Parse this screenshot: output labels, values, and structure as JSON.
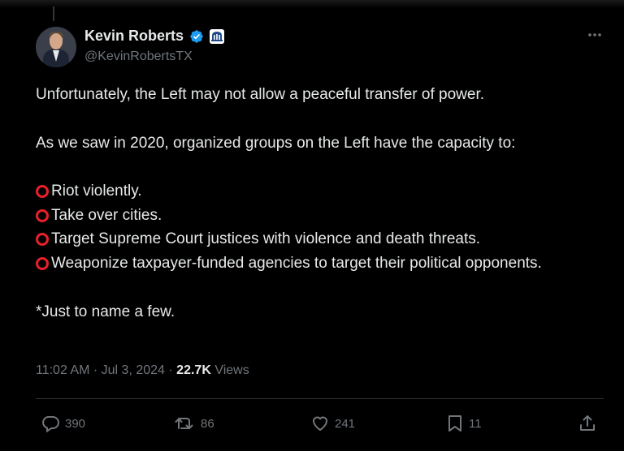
{
  "author": {
    "name": "Kevin Roberts",
    "handle": "@KevinRobertsTX",
    "verified": true,
    "affiliate_badge": "heritage-bell-icon"
  },
  "tweet": {
    "lines": [
      "Unfortunately, the Left may not allow a peaceful transfer of power.",
      "As we saw in 2020, organized groups on the Left have the capacity to:"
    ],
    "list_items": [
      "Riot violently.",
      "Take over cities.",
      "Target Supreme Court justices with violence and death threats.",
      "Weaponize taxpayer-funded agencies to target their political opponents."
    ],
    "closing": "*Just to name a few.",
    "list_marker": "red-hollow-circle-emoji"
  },
  "meta": {
    "time": "11:02 AM",
    "date": "Jul 3, 2024",
    "views_count": "22.7K",
    "views_label": "Views"
  },
  "actions": {
    "replies": "390",
    "reposts": "86",
    "likes": "241",
    "bookmarks": "11"
  },
  "colors": {
    "background": "#000000",
    "text": "#e7e9ea",
    "muted": "#71767b",
    "verified_blue": "#1d9bf0",
    "circle_red": "#e8202c"
  }
}
